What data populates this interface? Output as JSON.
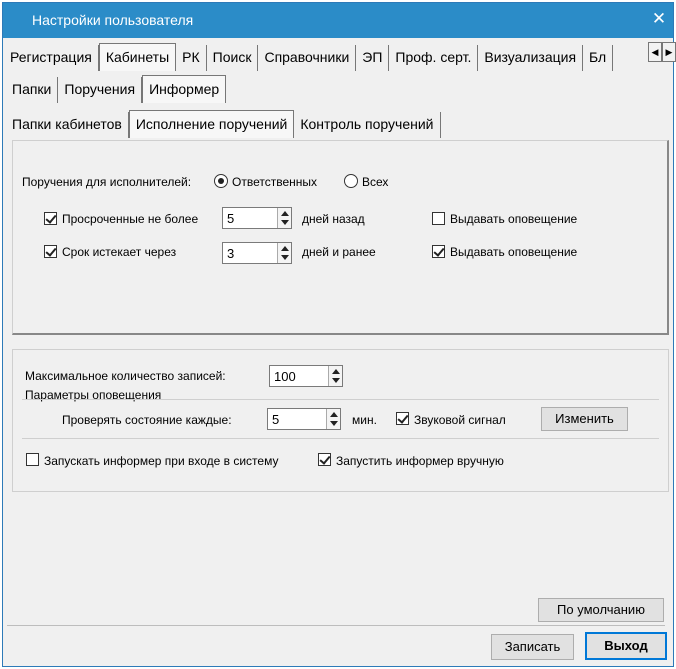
{
  "window": {
    "title": "Настройки пользователя"
  },
  "tabs_main": [
    "Регистрация",
    "Кабинеты",
    "РК",
    "Поиск",
    "Справочники",
    "ЭП",
    "Проф. серт.",
    "Визуализация",
    "Бл"
  ],
  "tabs_main_active": "Кабинеты",
  "tabs_sub": [
    "Папки",
    "Поручения",
    "Информер"
  ],
  "tabs_sub_active": "Информер",
  "tabs_sub2": [
    "Папки кабинетов",
    "Исполнение поручений",
    "Контроль поручений"
  ],
  "tabs_sub2_active": "Исполнение поручений",
  "execution": {
    "for_executors_label": "Поручения для исполнителей:",
    "radio_responsible": "Ответственных",
    "radio_all": "Всех",
    "overdue_label": "Просроченные не более",
    "overdue_value": "5",
    "overdue_suffix": "дней назад",
    "overdue_notify": "Выдавать оповещение",
    "expires_label": "Срок истекает через",
    "expires_value": "3",
    "expires_suffix": "дней и ранее",
    "expires_notify": "Выдавать оповещение"
  },
  "informer": {
    "max_records_label": "Максимальное количество записей:",
    "max_records_value": "100",
    "notify_params_label": "Параметры оповещения",
    "check_every_label": "Проверять состояние каждые:",
    "check_every_value": "5",
    "minutes_label": "мин.",
    "sound_label": "Звуковой сигнал",
    "change_button": "Изменить",
    "autostart_label": "Запускать информер при входе в систему",
    "manual_label": "Запустить информер вручную"
  },
  "buttons": {
    "defaults": "По умолчанию",
    "save": "Записать",
    "exit": "Выход"
  }
}
